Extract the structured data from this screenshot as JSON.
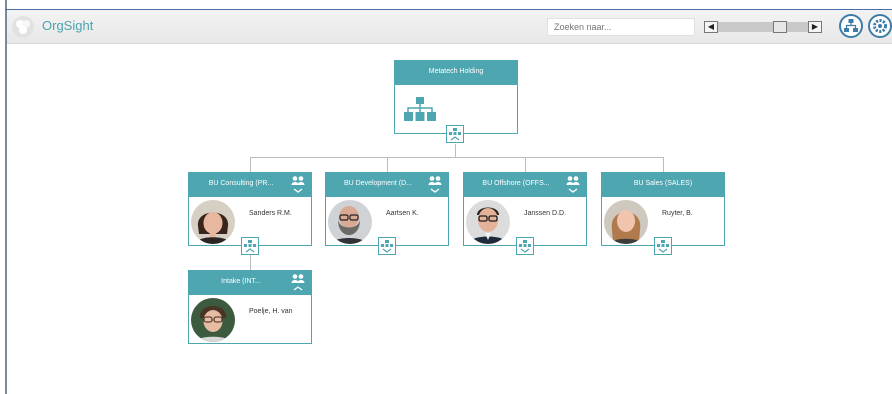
{
  "app": {
    "title": "OrgSight"
  },
  "search": {
    "placeholder": "Zoeken naar..."
  },
  "zoom": {
    "left_glyph": "◀",
    "right_glyph": "▶",
    "level": 0.73
  },
  "header_buttons": [
    {
      "icon": "org-structure-icon"
    },
    {
      "icon": "settings-icon"
    }
  ],
  "colors": {
    "accent": "#4ea6b1",
    "title": "#4aa3b0",
    "header_bg": "#efefef"
  },
  "root": {
    "title": "Metatech Holding",
    "icon": "org-chart-icon"
  },
  "units": [
    {
      "title": "BU Consulting (PR...",
      "person": "Sanders R.M."
    },
    {
      "title": "BU Development (D...",
      "person": "Aartsen K."
    },
    {
      "title": "BU Offshore (OFFS...",
      "person": "Janssen D.D."
    },
    {
      "title": "BU Sales (SALES)",
      "person": "Ruyter, B."
    }
  ],
  "subunits": [
    {
      "title": "Intake (INT...",
      "person": "Poelje, H. van"
    }
  ]
}
